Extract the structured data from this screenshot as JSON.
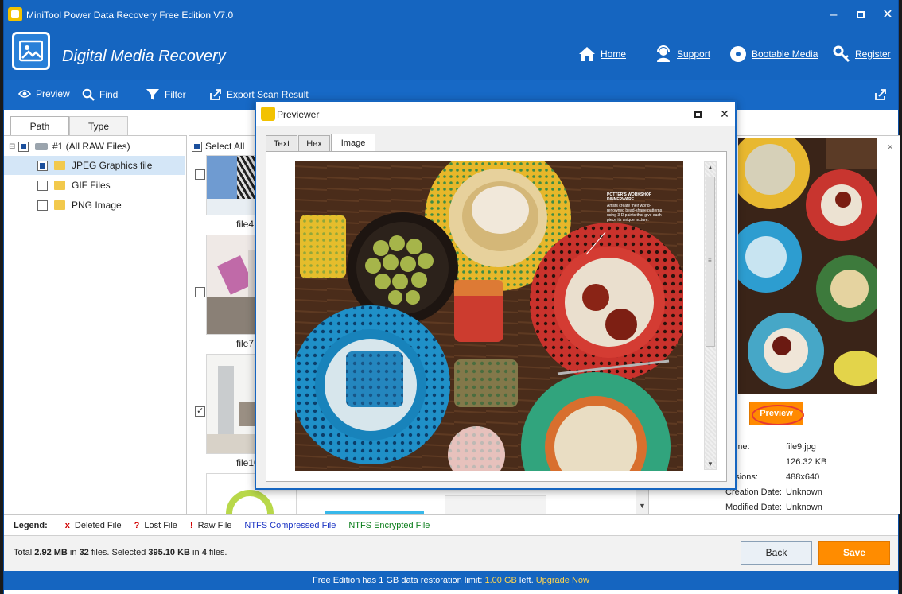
{
  "window": {
    "title": "MiniTool Power Data Recovery Free Edition V7.0"
  },
  "header": {
    "product": "Digital Media Recovery",
    "links": {
      "home": "Home",
      "support": "Support",
      "bootable": "Bootable Media",
      "register": "Register"
    }
  },
  "toolbar": {
    "preview": "Preview",
    "find": "Find",
    "filter": "Filter",
    "export": "Export Scan Result"
  },
  "tabs": {
    "path": "Path",
    "type": "Type"
  },
  "tree": {
    "root": "#1 (All RAW Files)",
    "items": [
      {
        "label": "JPEG Graphics file"
      },
      {
        "label": "GIF Files"
      },
      {
        "label": "PNG Image"
      }
    ]
  },
  "grid": {
    "select_all": "Select All",
    "files": [
      {
        "name": "file4.",
        "mark": ""
      },
      {
        "name": "file7.",
        "mark": "!"
      },
      {
        "name": "file10",
        "mark": "!"
      },
      {
        "name": "",
        "mark": "!"
      }
    ]
  },
  "right_panel": {
    "close": "×",
    "preview_button": "Preview",
    "meta": [
      {
        "k": "name:",
        "v": "file9.jpg"
      },
      {
        "k": ":",
        "v": "126.32 KB"
      },
      {
        "k": "ensions:",
        "v": "488x640"
      },
      {
        "k": "Creation Date:",
        "v": "Unknown"
      },
      {
        "k": "Modified Date:",
        "v": "Unknown"
      }
    ]
  },
  "legend": {
    "label": "Legend:",
    "deleted_mark": "x",
    "deleted": "Deleted File",
    "lost_mark": "?",
    "lost": "Lost File",
    "raw_mark": "!",
    "raw": "Raw File",
    "compressed": "NTFS Compressed File",
    "encrypted": "NTFS Encrypted File",
    "colors": {
      "deleted": "#d10000",
      "compressed": "#1a33c4",
      "encrypted": "#0a7d1a"
    }
  },
  "status": {
    "total_prefix": "Total ",
    "total_size": "2.92 MB",
    "in": " in ",
    "total_files": "32",
    "files_sel": " files.  Selected ",
    "sel_size": "395.10 KB",
    "in2": " in ",
    "sel_files": "4",
    "files_end": " files.",
    "back": "Back",
    "save": "Save"
  },
  "footer": {
    "text": "Free Edition has 1 GB data restoration limit: ",
    "limit": "1.00 GB",
    "left": " left. ",
    "upgrade": "Upgrade Now"
  },
  "previewer": {
    "title": "Previewer",
    "tabs": {
      "text": "Text",
      "hex": "Hex",
      "image": "Image"
    },
    "caption_title": "POTTER'S WORKSHOP DINNERWARE",
    "caption_body": "Artists create their world-renowned bead-shape patterns using 3-D paints that give each piece its unique texture."
  },
  "colors": {
    "brand": "#1565c0",
    "accent": "#ff8c00"
  }
}
